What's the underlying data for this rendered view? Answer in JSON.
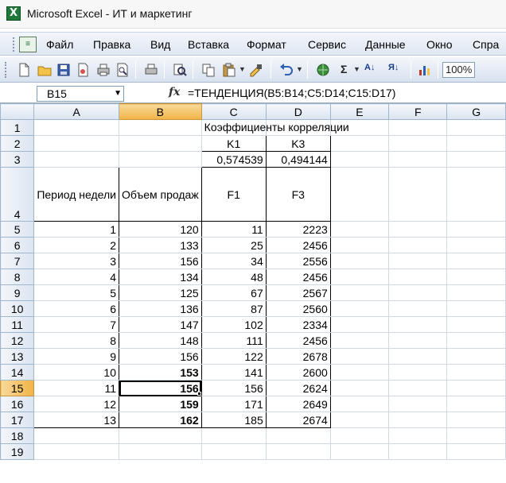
{
  "window": {
    "title": "Microsoft Excel - ИТ и маркетинг",
    "app_icon": "X"
  },
  "menu": {
    "doc_icon": "≡",
    "items": [
      "Файл",
      "Правка",
      "Вид",
      "Вставка",
      "Формат",
      "Сервис",
      "Данные",
      "Окно",
      "Спра"
    ]
  },
  "toolbar": {
    "sum_label": "Σ",
    "zoom": "100%",
    "sort_asc": "А↓",
    "sort_desc": "Я↓"
  },
  "formula_bar": {
    "name_box": "B15",
    "fx_label": "fx",
    "formula": "=ТЕНДЕНЦИЯ(B5:B14;C5:D14;C15:D17)"
  },
  "sheet": {
    "columns": [
      "A",
      "B",
      "C",
      "D",
      "E",
      "F",
      "G"
    ],
    "rows": [
      "1",
      "2",
      "3",
      "4",
      "5",
      "6",
      "7",
      "8",
      "9",
      "10",
      "11",
      "12",
      "13",
      "14",
      "15",
      "16",
      "17",
      "18",
      "19"
    ],
    "corr_title": "Коэффициенты корреляции",
    "k1_label": "K1",
    "k3_label": "K3",
    "k1_value": "0,574539",
    "k3_value": "0,494144",
    "header_period": "Период недели",
    "header_volume": "Объем продаж",
    "header_f1": "F1",
    "header_f3": "F3",
    "data": [
      {
        "a": "1",
        "b": "120",
        "c": "11",
        "d": "2223"
      },
      {
        "a": "2",
        "b": "133",
        "c": "25",
        "d": "2456"
      },
      {
        "a": "3",
        "b": "156",
        "c": "34",
        "d": "2556"
      },
      {
        "a": "4",
        "b": "134",
        "c": "48",
        "d": "2456"
      },
      {
        "a": "5",
        "b": "125",
        "c": "67",
        "d": "2567"
      },
      {
        "a": "6",
        "b": "136",
        "c": "87",
        "d": "2560"
      },
      {
        "a": "7",
        "b": "147",
        "c": "102",
        "d": "2334"
      },
      {
        "a": "8",
        "b": "148",
        "c": "111",
        "d": "2456"
      },
      {
        "a": "9",
        "b": "156",
        "c": "122",
        "d": "2678"
      },
      {
        "a": "10",
        "b": "153",
        "c": "141",
        "d": "2600"
      },
      {
        "a": "11",
        "b": "156",
        "c": "156",
        "d": "2624"
      },
      {
        "a": "12",
        "b": "159",
        "c": "171",
        "d": "2649"
      },
      {
        "a": "13",
        "b": "162",
        "c": "185",
        "d": "2674"
      }
    ],
    "active_cell": "B15",
    "selected_column": "B",
    "selected_row": "15"
  }
}
